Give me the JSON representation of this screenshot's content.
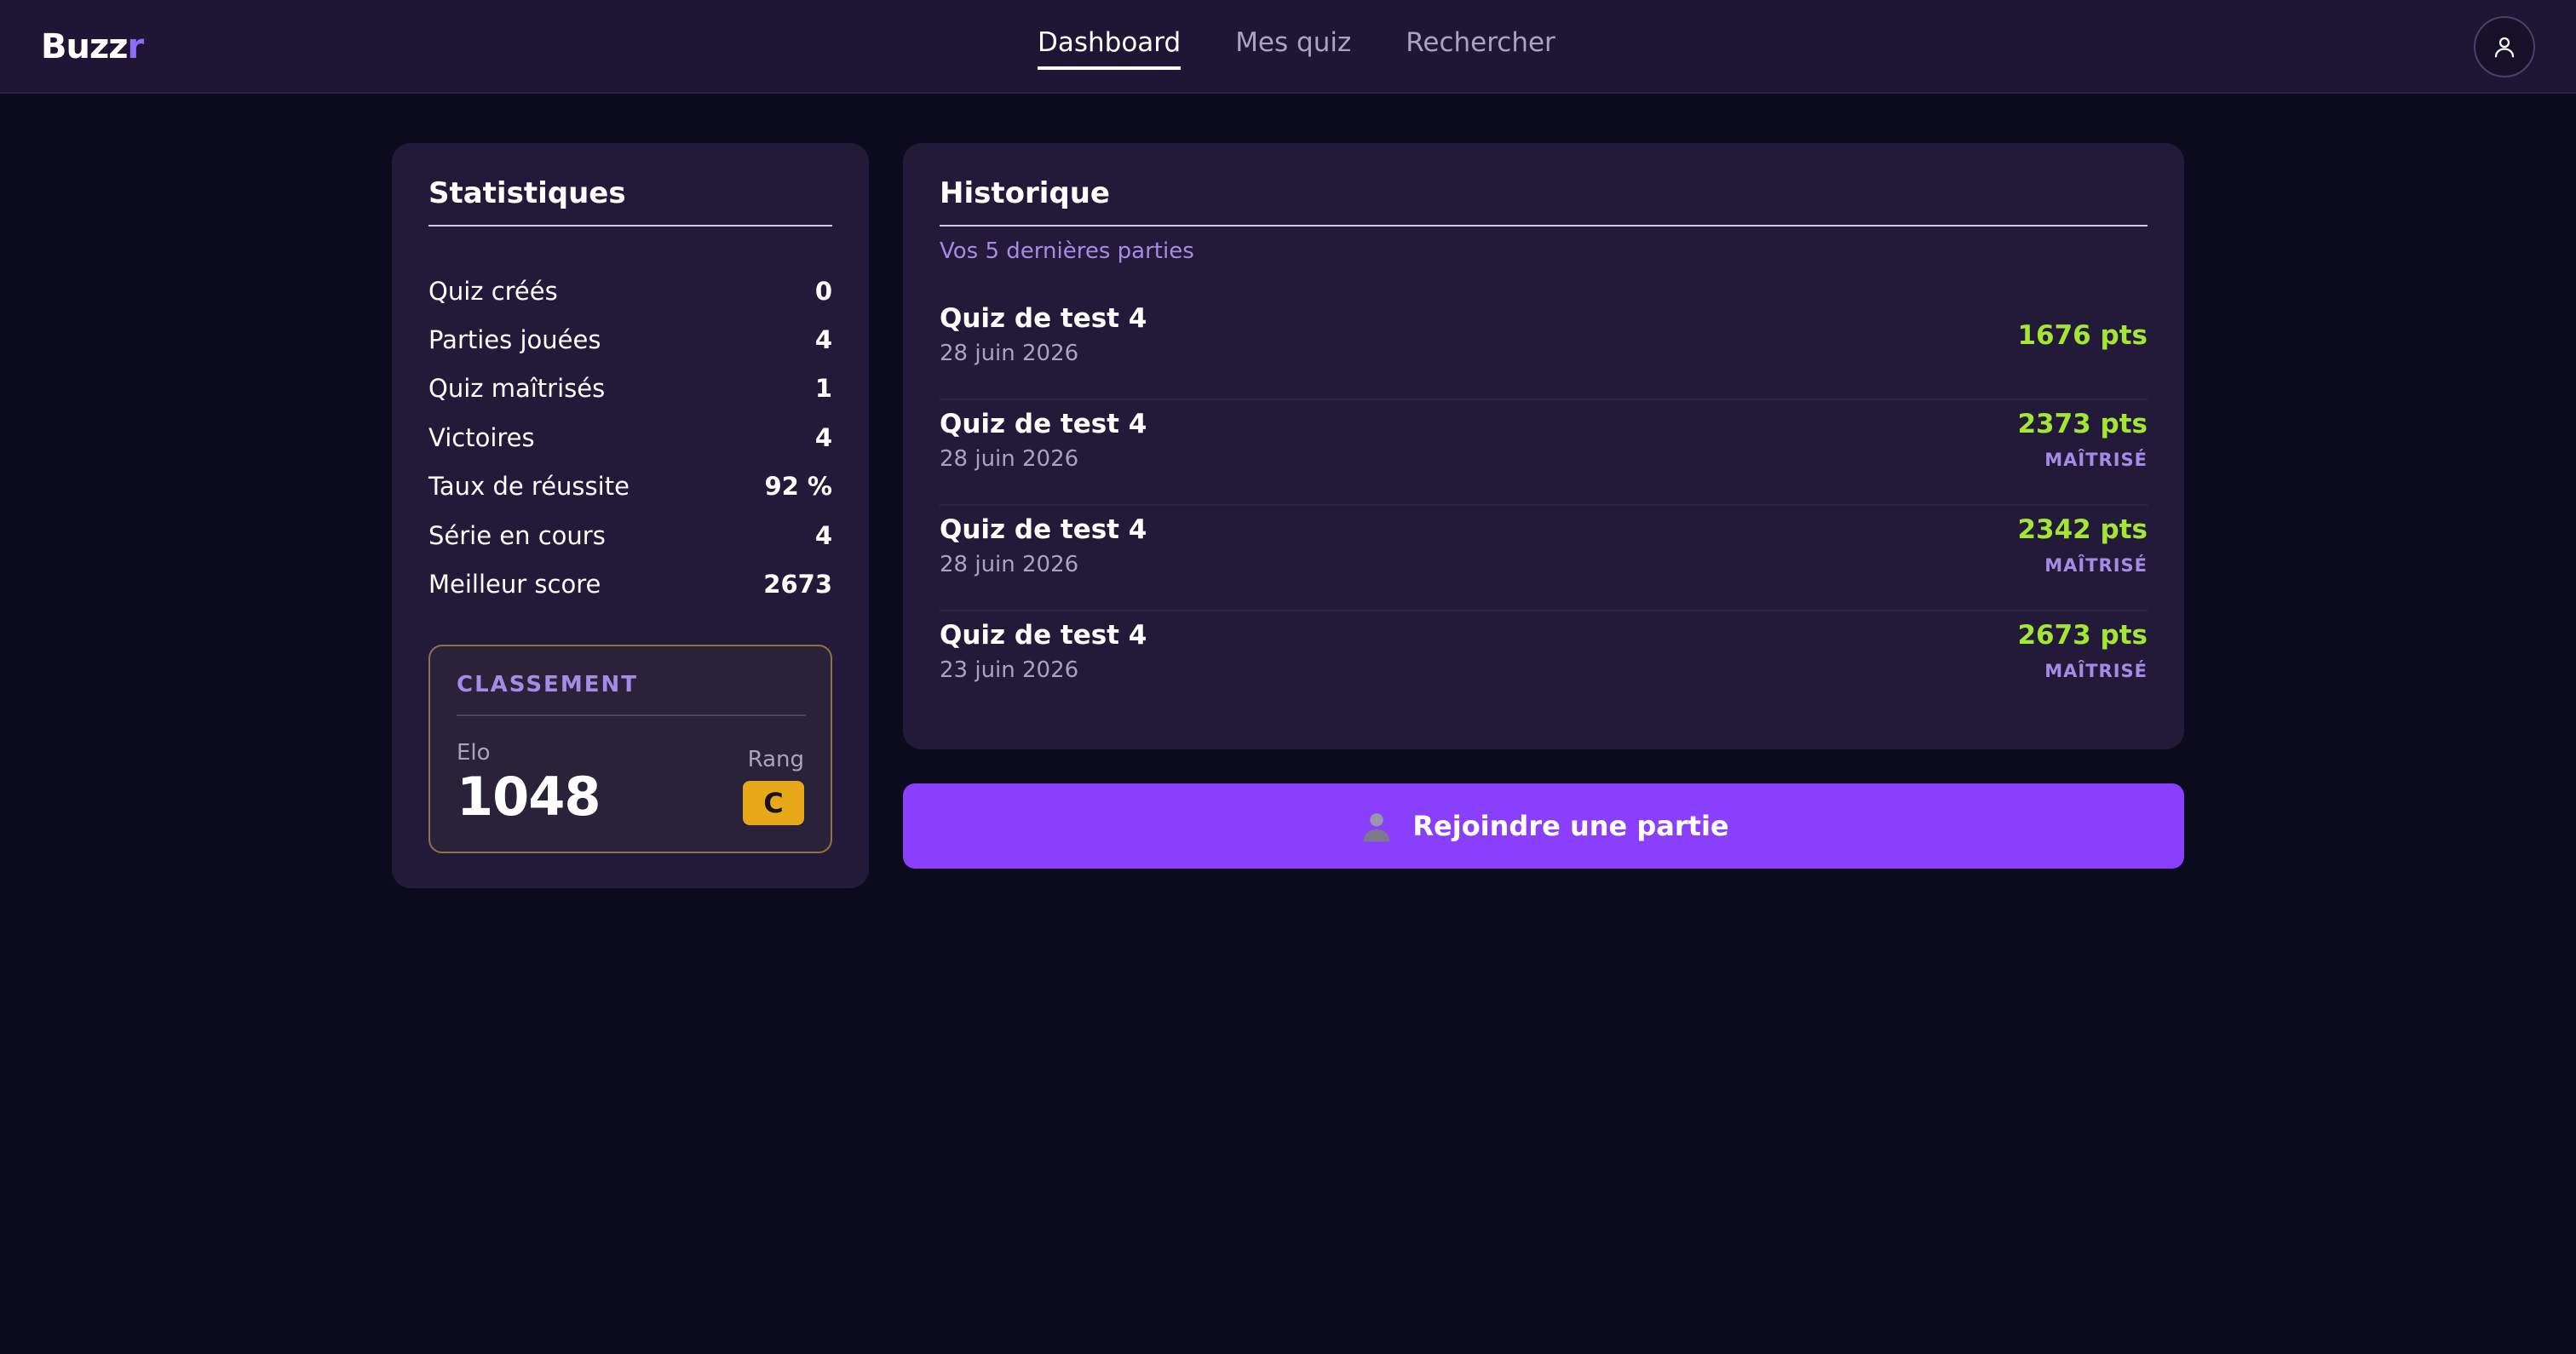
{
  "header": {
    "logo_main": "Buzz",
    "logo_accent": "r",
    "tabs": [
      {
        "label": "Dashboard"
      },
      {
        "label": "Mes quiz"
      },
      {
        "label": "Rechercher"
      }
    ],
    "avatar_icon": "user-icon"
  },
  "stats": {
    "title": "Statistiques",
    "rows": [
      {
        "label": "Quiz créés",
        "value": "0"
      },
      {
        "label": "Parties jouées",
        "value": "4"
      },
      {
        "label": "Quiz maîtrisés",
        "value": "1"
      },
      {
        "label": "Victoires",
        "value": "4"
      },
      {
        "label": "Taux de réussite",
        "value": "92 %"
      },
      {
        "label": "Série en cours",
        "value": "4"
      },
      {
        "label": "Meilleur score",
        "value": "2673"
      }
    ],
    "ranking": {
      "title": "CLASSEMENT",
      "elo_label": "Elo",
      "elo_value": "1048",
      "rank_label": "Rang",
      "rank_value": "C",
      "rank_color": "#e7a81a"
    }
  },
  "history": {
    "title": "Historique",
    "subtitle": "Vos 5 dernières parties",
    "items": [
      {
        "name": "Quiz de test 4",
        "date": "28 juin 2026",
        "score": "1676 pts",
        "tag": ""
      },
      {
        "name": "Quiz de test 4",
        "date": "28 juin 2026",
        "score": "2373 pts",
        "tag": "MAÎTRISÉ"
      },
      {
        "name": "Quiz de test 4",
        "date": "28 juin 2026",
        "score": "2342 pts",
        "tag": "MAÎTRISÉ"
      },
      {
        "name": "Quiz de test 4",
        "date": "23 juin 2026",
        "score": "2673 pts",
        "tag": "MAÎTRISÉ"
      }
    ]
  },
  "join": {
    "label": "Rejoindre une partie",
    "icon": "person-silhouette-icon"
  },
  "colors": {
    "background": "#0c0b1d",
    "card": "#221a38",
    "accent": "#8a3ffc",
    "score": "#a3e635",
    "tag": "#a48ce6"
  }
}
